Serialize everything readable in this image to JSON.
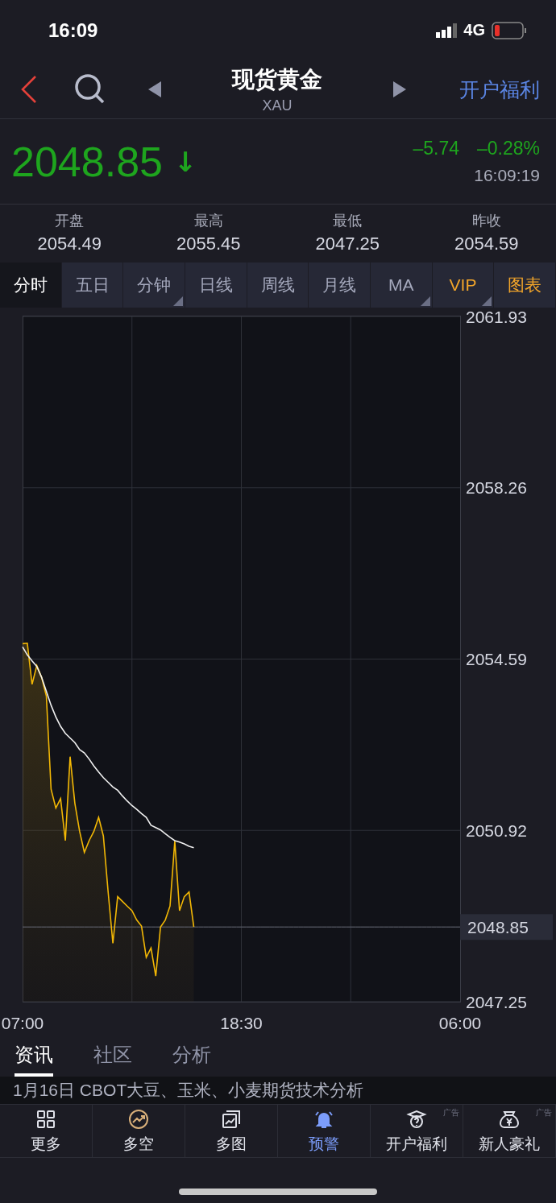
{
  "status_bar": {
    "time": "16:09",
    "network": "4G"
  },
  "nav": {
    "title": "现货黄金",
    "subtitle": "XAU",
    "promo": "开户福利"
  },
  "quote": {
    "price": "2048.85",
    "arrow": "↓",
    "change": "–5.74",
    "change_pct": "–0.28%",
    "time": "16:09:19"
  },
  "stats": [
    {
      "label": "开盘",
      "value": "2054.49"
    },
    {
      "label": "最高",
      "value": "2055.45"
    },
    {
      "label": "最低",
      "value": "2047.25"
    },
    {
      "label": "昨收",
      "value": "2054.59"
    }
  ],
  "period_tabs": [
    {
      "label": "分时",
      "selected": true,
      "dropdown": false,
      "highlighted": false
    },
    {
      "label": "五日",
      "selected": false,
      "dropdown": false,
      "highlighted": false
    },
    {
      "label": "分钟",
      "selected": false,
      "dropdown": true,
      "highlighted": false
    },
    {
      "label": "日线",
      "selected": false,
      "dropdown": false,
      "highlighted": false
    },
    {
      "label": "周线",
      "selected": false,
      "dropdown": false,
      "highlighted": false
    },
    {
      "label": "月线",
      "selected": false,
      "dropdown": false,
      "highlighted": false
    },
    {
      "label": "MA",
      "selected": false,
      "dropdown": true,
      "highlighted": false
    },
    {
      "label": "VIP",
      "selected": false,
      "dropdown": true,
      "highlighted": true
    },
    {
      "label": "图表",
      "selected": false,
      "dropdown": false,
      "highlighted": true
    }
  ],
  "chart": {
    "chart_data": {
      "type": "line",
      "grid": true,
      "categories": [
        "07:00",
        null,
        null,
        null,
        null,
        null,
        null,
        null,
        null,
        null,
        null,
        null,
        null,
        null,
        null,
        null,
        null,
        null,
        null,
        null,
        null,
        null,
        null,
        null,
        null,
        null,
        null,
        null,
        null,
        null,
        null,
        null,
        null,
        null,
        null,
        null,
        null,
        null,
        null,
        null,
        null,
        null,
        null,
        null,
        null,
        null,
        "18:30",
        null,
        null,
        null,
        null,
        null,
        null,
        null,
        null,
        null,
        null,
        null,
        null,
        null,
        null,
        null,
        null,
        null,
        null,
        null,
        null,
        null,
        null,
        null,
        null,
        null,
        null,
        null,
        null,
        null,
        null,
        null,
        null,
        null,
        null,
        null,
        null,
        null,
        null,
        null,
        null,
        null,
        null,
        null,
        null,
        null,
        "06:00"
      ],
      "series": [
        {
          "color": "#f2b705",
          "values": [
            2054.92,
            2054.93,
            2054.05,
            2054.45,
            2054.2,
            2053.8,
            2051.8,
            2051.4,
            2051.6,
            2050.7,
            2052.5,
            2051.5,
            2050.9,
            2050.45,
            2050.7,
            2050.9,
            2051.2,
            2050.8,
            2049.6,
            2048.5,
            2049.5,
            2049.4,
            2049.3,
            2049.2,
            2049.0,
            2048.87,
            2048.2,
            2048.4,
            2047.8,
            2048.85,
            2049.0,
            2049.3,
            2050.69,
            2049.2,
            2049.5,
            2049.6,
            2048.85,
            null,
            null,
            null,
            null,
            null,
            null,
            null,
            null,
            null,
            null,
            null,
            null,
            null,
            null,
            null,
            null,
            null,
            null,
            null,
            null,
            null,
            null,
            null,
            null,
            null,
            null,
            null,
            null,
            null,
            null,
            null,
            null,
            null,
            null,
            null,
            null,
            null,
            null,
            null,
            null,
            null,
            null,
            null,
            null,
            null,
            null,
            null,
            null,
            null,
            null,
            null,
            null,
            null,
            null,
            null,
            null
          ]
        },
        {
          "color": "#f0f0f0",
          "values": [
            2054.85,
            2054.68,
            2054.55,
            2054.43,
            2054.2,
            2053.9,
            2053.6,
            2053.35,
            2053.15,
            2053.0,
            2052.9,
            2052.8,
            2052.65,
            2052.58,
            2052.45,
            2052.3,
            2052.17,
            2052.05,
            2051.95,
            2051.85,
            2051.78,
            2051.66,
            2051.55,
            2051.45,
            2051.37,
            2051.28,
            2051.2,
            2051.03,
            2050.98,
            2050.93,
            2050.85,
            2050.77,
            2050.7,
            2050.67,
            2050.63,
            2050.58,
            2050.55,
            null,
            null,
            null,
            null,
            null,
            null,
            null,
            null,
            null,
            null,
            null,
            null,
            null,
            null,
            null,
            null,
            null,
            null,
            null,
            null,
            null,
            null,
            null,
            null,
            null,
            null,
            null,
            null,
            null,
            null,
            null,
            null,
            null,
            null,
            null,
            null,
            null,
            null,
            null,
            null,
            null,
            null,
            null,
            null,
            null,
            null,
            null,
            null,
            null,
            null,
            null,
            null,
            null,
            null,
            null,
            null
          ]
        },
        {
          "color": "#6a6d7a",
          "values": [
            2048.85,
            2048.85,
            2048.85,
            2048.85,
            2048.85,
            2048.85,
            2048.85,
            2048.85,
            2048.85,
            2048.85,
            2048.85,
            2048.85,
            2048.85,
            2048.85,
            2048.85,
            2048.85,
            2048.85,
            2048.85,
            2048.85,
            2048.85,
            2048.85,
            2048.85,
            2048.85,
            2048.85,
            2048.85,
            2048.85,
            2048.85,
            2048.85,
            2048.85,
            2048.85,
            2048.85,
            2048.85,
            2048.85,
            2048.85,
            2048.85,
            2048.85,
            2048.85,
            2048.85,
            2048.85,
            2048.85,
            2048.85,
            2048.85,
            2048.85,
            2048.85,
            2048.85,
            2048.85,
            2048.85,
            2048.85,
            2048.85,
            2048.85,
            2048.85,
            2048.85,
            2048.85,
            2048.85,
            2048.85,
            2048.85,
            2048.85,
            2048.85,
            2048.85,
            2048.85,
            2048.85,
            2048.85,
            2048.85,
            2048.85,
            2048.85,
            2048.85,
            2048.85,
            2048.85,
            2048.85,
            2048.85,
            2048.85,
            2048.85,
            2048.85,
            2048.85,
            2048.85,
            2048.85,
            2048.85,
            2048.85,
            2048.85,
            2048.85,
            2048.85,
            2048.85,
            2048.85,
            2048.85,
            2048.85,
            2048.85,
            2048.85,
            2048.85,
            2048.85,
            2048.85,
            2048.85,
            2048.85,
            2048.85
          ]
        }
      ],
      "ylim": [
        2047.25,
        2061.93
      ],
      "yticks": [
        2061.93,
        2058.26,
        2054.59,
        2050.92,
        2047.25
      ]
    },
    "price_marker": "2048.85"
  },
  "content_tabs": [
    {
      "label": "资讯",
      "selected": true
    },
    {
      "label": "社区",
      "selected": false
    },
    {
      "label": "分析",
      "selected": false
    }
  ],
  "news": [
    {
      "title": "1月16日 CBOT大豆、玉米、小麦期货技术分析"
    }
  ],
  "toolbar": [
    {
      "kind": "grid",
      "label": "更多",
      "selected": false
    },
    {
      "kind": "trend",
      "label": "多空",
      "selected": false
    },
    {
      "kind": "charts",
      "label": "多图",
      "selected": false
    },
    {
      "kind": "bell",
      "label": "预警",
      "selected": true
    },
    {
      "kind": "cap",
      "label": "开户福利",
      "selected": false,
      "ad_tag": "广告"
    },
    {
      "kind": "bag",
      "label": "新人豪礼",
      "selected": false,
      "ad_tag": "广告"
    }
  ]
}
